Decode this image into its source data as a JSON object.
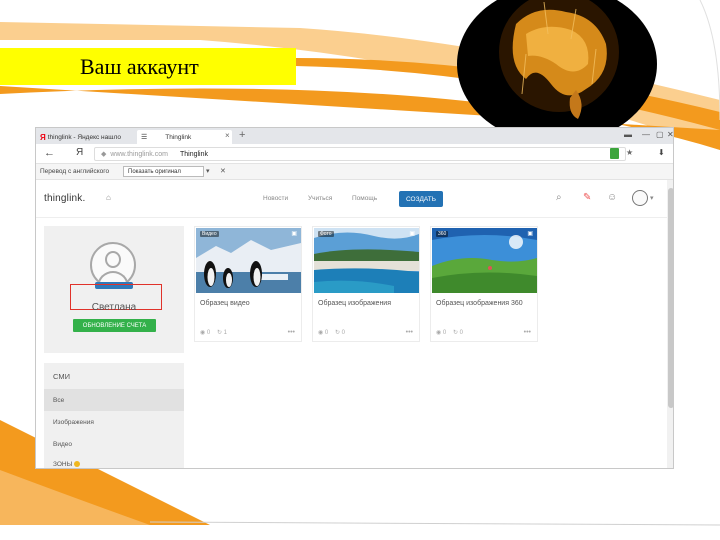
{
  "slide": {
    "title": "Ваш аккаунт"
  },
  "browser": {
    "tabs": [
      {
        "label": "thinglink - Яндекс нашло"
      },
      {
        "label": "Thinglink"
      }
    ],
    "address": {
      "domain": "www.thinglink.com",
      "page_title": "Thinglink"
    },
    "translate_bar": {
      "label": "Перевод с английского",
      "button": "Показать оригинал"
    }
  },
  "site": {
    "logo": "thinglink.",
    "nav": [
      "Новости",
      "Учиться",
      "Помощь"
    ],
    "create_button": "СОЗДАТЬ"
  },
  "profile": {
    "name": "Светлана",
    "upgrade_button": "ОБНОВЛЕНИЕ СЧЕТА"
  },
  "filters": {
    "heading": "СМИ",
    "items": [
      "Все",
      "Изображения",
      "Видео"
    ],
    "partial_item": "ЗОНЫ"
  },
  "cards": [
    {
      "badge": "Видео",
      "title": "Образец видео",
      "views": "0",
      "shares": "1"
    },
    {
      "badge": "Фото",
      "title": "Образец изображения",
      "views": "0",
      "shares": "0"
    },
    {
      "badge": "360",
      "title": "Образец изображения 360",
      "views": "0",
      "shares": "0"
    }
  ],
  "colors": {
    "accent_orange": "#f39a1e",
    "title_highlight": "#ffff00",
    "create_button": "#2372b4",
    "upgrade_button": "#33b14a",
    "highlight_box": "#e0322a"
  }
}
